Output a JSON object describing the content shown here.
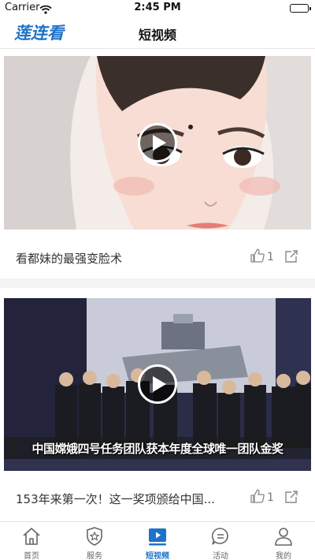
{
  "status_bar": {
    "carrier": "Carrier",
    "time": "2:45 PM"
  },
  "header": {
    "logo_text": "莲连看",
    "title": "短视频"
  },
  "feed": [
    {
      "title": "看都妹的最强变脸术",
      "likes": "1",
      "overlay_text": ""
    },
    {
      "title": "153年来第一次！这一奖项颁给中国...",
      "likes": "1",
      "overlay_text": "中国嫦娥四号任务团队获本年度全球唯一团队金奖"
    }
  ],
  "tabs": [
    {
      "label": "首页",
      "icon": "home-icon",
      "active": false
    },
    {
      "label": "服务",
      "icon": "shield-star-icon",
      "active": false
    },
    {
      "label": "短视频",
      "icon": "video-icon",
      "active": true
    },
    {
      "label": "活动",
      "icon": "chat-icon",
      "active": false
    },
    {
      "label": "我的",
      "icon": "person-icon",
      "active": false
    }
  ],
  "colors": {
    "accent": "#1d73c9",
    "text": "#333333",
    "muted": "#777777"
  }
}
